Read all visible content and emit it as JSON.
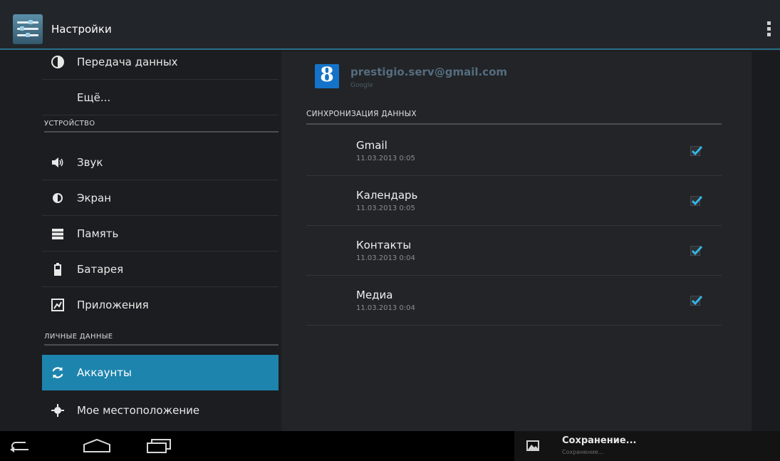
{
  "app": {
    "title": "Настройки",
    "icon": "settings-sliders-icon"
  },
  "left_menu": {
    "items_top": [
      {
        "label": "Передача данных",
        "icon": "data-usage-icon"
      },
      {
        "label": "Ещё..."
      }
    ],
    "section_device": "УСТРОЙСТВО",
    "device_items": [
      {
        "label": "Звук",
        "icon": "speaker-icon"
      },
      {
        "label": "Экран",
        "icon": "brightness-icon"
      },
      {
        "label": "Память",
        "icon": "storage-icon"
      },
      {
        "label": "Батарея",
        "icon": "battery-icon"
      },
      {
        "label": "Приложения",
        "icon": "apps-icon"
      }
    ],
    "section_personal": "ЛИЧНЫЕ ДАННЫЕ",
    "personal_items": [
      {
        "label": "Аккаунты",
        "icon": "sync-icon",
        "selected": true
      },
      {
        "label": "Мое местоположение",
        "icon": "location-icon"
      }
    ]
  },
  "account": {
    "email": "prestigio.serv@gmail.com",
    "provider": "Google",
    "icon_letter": "8",
    "sync_header": "СИНХРОНИЗАЦИЯ ДАННЫХ",
    "sync_items": [
      {
        "name": "Gmail",
        "date": "11.03.2013 0:05",
        "checked": true
      },
      {
        "name": "Календарь",
        "date": "11.03.2013 0:05",
        "checked": true
      },
      {
        "name": "Контакты",
        "date": "11.03.2013 0:04",
        "checked": true
      },
      {
        "name": "Медиа",
        "date": "11.03.2013 0:04",
        "checked": true
      }
    ]
  },
  "system_bar": {
    "nav": [
      "back-icon",
      "home-icon",
      "recent-apps-icon"
    ],
    "notification": {
      "icon": "image-icon",
      "title": "Сохранение...",
      "subtitle": "Сохранение..."
    }
  },
  "colors": {
    "accent": "#1d84ad",
    "action_bar_divider": "#2b6f8b",
    "checkbox": "#35b5e5",
    "google_icon": "#1473c8"
  }
}
